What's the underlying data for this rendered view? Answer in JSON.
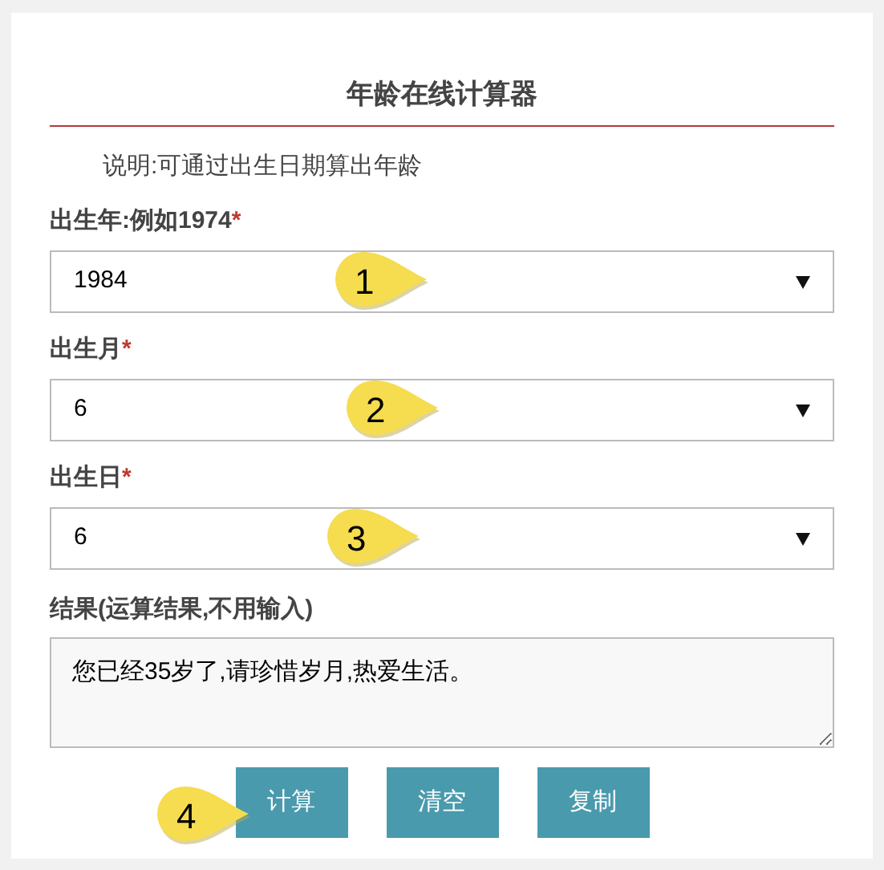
{
  "title": "年龄在线计算器",
  "description": "说明:可通过出生日期算出年龄",
  "fields": [
    {
      "label": "出生年:例如1974",
      "required_mark": "*",
      "value": "1984",
      "callout": "1"
    },
    {
      "label": "出生月",
      "required_mark": "*",
      "value": "6",
      "callout": "2"
    },
    {
      "label": "出生日",
      "required_mark": "*",
      "value": "6",
      "callout": "3"
    }
  ],
  "result": {
    "label": "结果(运算结果,不用输入)",
    "value": "您已经35岁了,请珍惜岁月,热爱生活。"
  },
  "buttons": [
    {
      "label": "计算",
      "callout": "4"
    },
    {
      "label": "清空"
    },
    {
      "label": "复制"
    }
  ]
}
